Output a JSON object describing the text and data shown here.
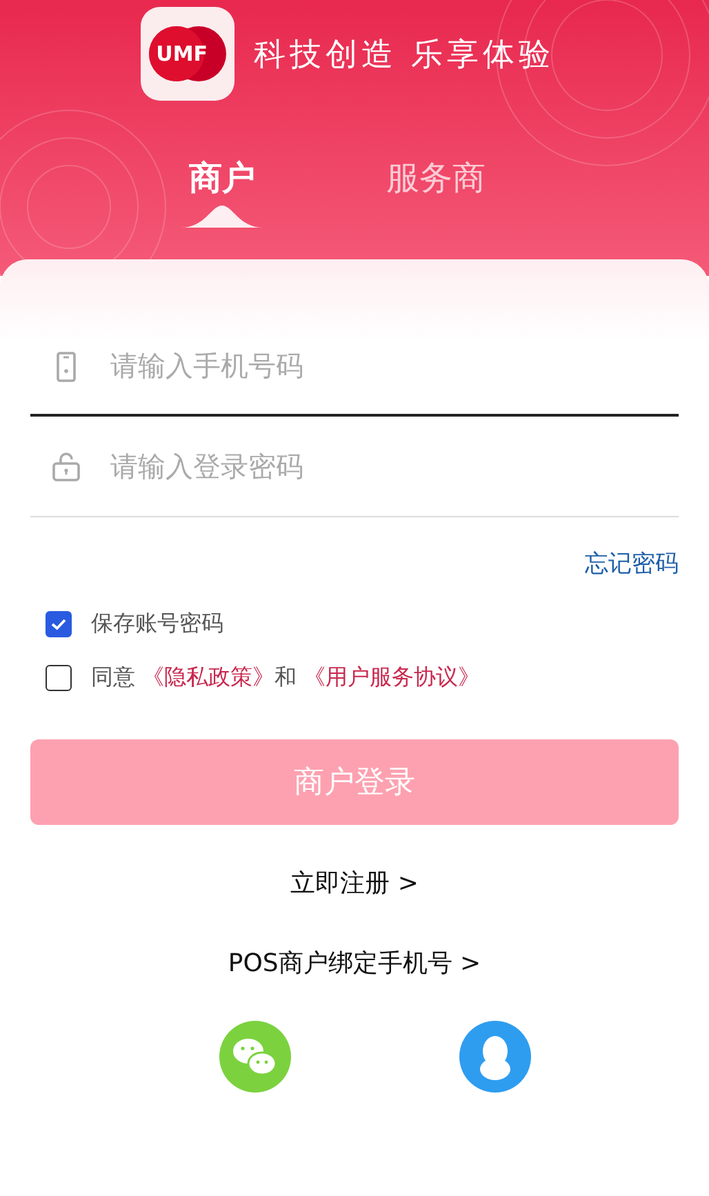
{
  "brand": {
    "logo_text": "UMF",
    "slogan": "科技创造 乐享体验"
  },
  "tabs": [
    {
      "label": "商户",
      "selected": true
    },
    {
      "label": "服务商",
      "selected": false
    }
  ],
  "fields": [
    {
      "kind": "phone",
      "placeholder": "请输入手机号码",
      "focused": true
    },
    {
      "kind": "password",
      "placeholder": "请输入登录密码",
      "focused": false
    }
  ],
  "forgot_link": "忘记密码",
  "remember": {
    "label": "保存账号密码",
    "checked": true
  },
  "agreement": {
    "checked": false,
    "prefix": "同意",
    "link_1": "《隐私政策》",
    "middle": "和",
    "link_2": "《用户服务协议》"
  },
  "login_button": {
    "label": "商户登录",
    "disabled": true
  },
  "links": [
    "立即注册 >",
    "POS商户绑定手机号 >"
  ],
  "social": [
    {
      "kind": "wechat"
    },
    {
      "kind": "qq"
    }
  ]
}
